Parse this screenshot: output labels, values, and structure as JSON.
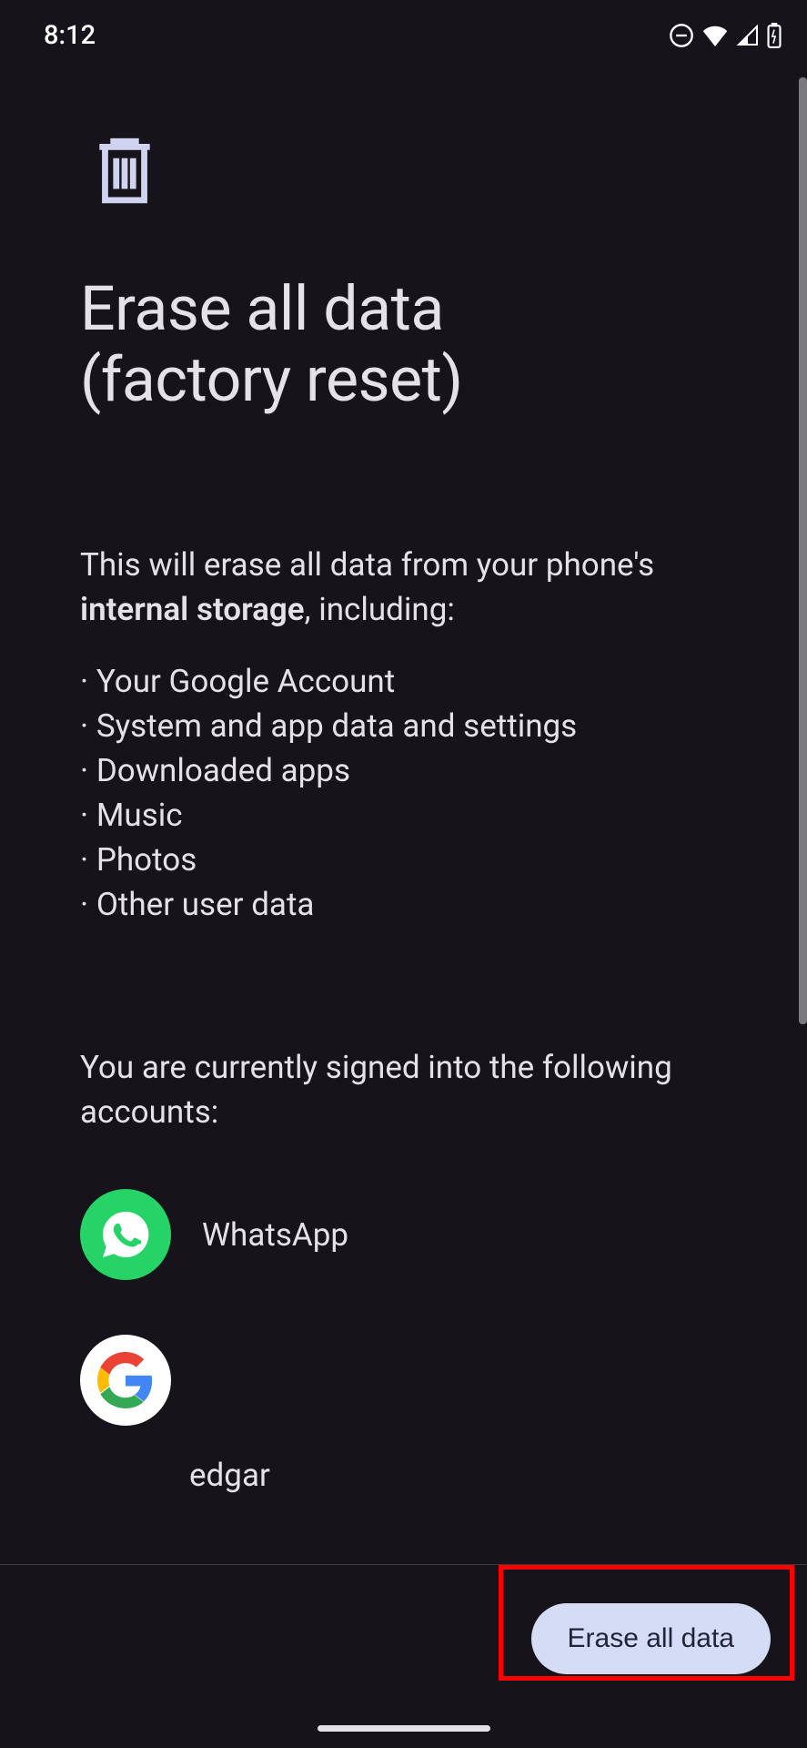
{
  "status": {
    "time": "8:12"
  },
  "page": {
    "title_line1": "Erase all data",
    "title_line2": "(factory reset)",
    "description_prefix": "This will erase all data from your phone's ",
    "description_bold": "internal storage",
    "description_suffix": ", including:",
    "bullets": [
      "Your Google Account",
      "System and app data and settings",
      "Downloaded apps",
      "Music",
      "Photos",
      "Other user data"
    ],
    "accounts_text": "You are currently signed into the following accounts:",
    "accounts": [
      {
        "name": "WhatsApp",
        "type": "whatsapp"
      },
      {
        "name": "",
        "type": "google"
      },
      {
        "name": "edgar",
        "type": "text"
      }
    ],
    "button_label": "Erase all data"
  }
}
